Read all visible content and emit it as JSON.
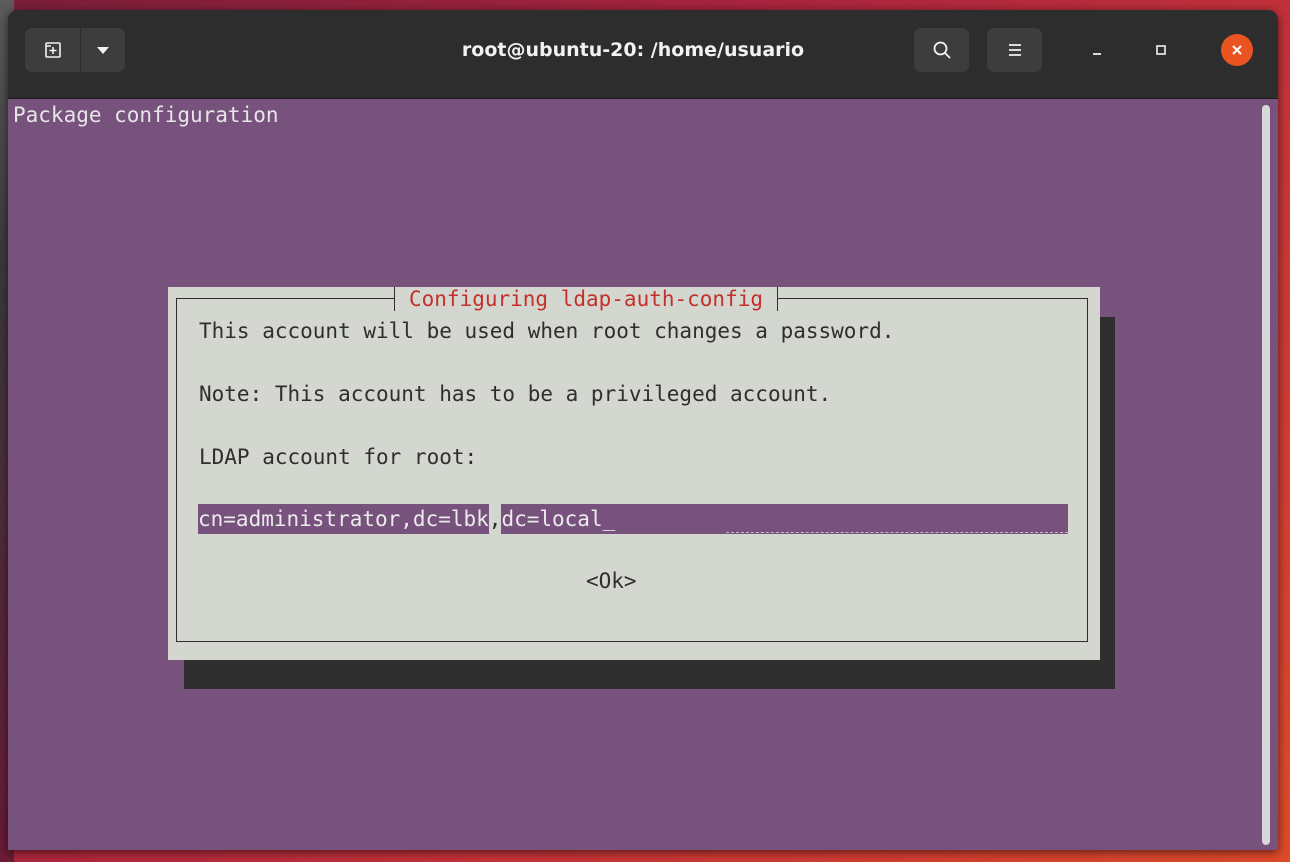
{
  "window": {
    "title": "root@ubuntu-20: /home/usuario"
  },
  "icons": {
    "new_tab": "new-tab-icon",
    "dropdown": "chevron-down-icon",
    "search": "search-icon",
    "menu": "hamburger-menu-icon",
    "minimize": "minimize-icon",
    "maximize": "maximize-icon",
    "close": "close-icon"
  },
  "terminal": {
    "header": "Package configuration",
    "background_color": "#76527c"
  },
  "dialog": {
    "title": "Configuring ldap-auth-config",
    "line1": "This account will be used when root changes a password.",
    "line2": "Note: This account has to be a privileged account.",
    "prompt": "LDAP account for root:",
    "input_value_part1": "cn=administrator,dc=lbk",
    "input_separator": ",",
    "input_value_part2": "dc=local_",
    "ok_button": "<Ok>",
    "title_color": "#c4302b",
    "background_color": "#d3d7cf"
  },
  "colors": {
    "close_button": "#e95420",
    "titlebar": "#2d2d2d"
  }
}
